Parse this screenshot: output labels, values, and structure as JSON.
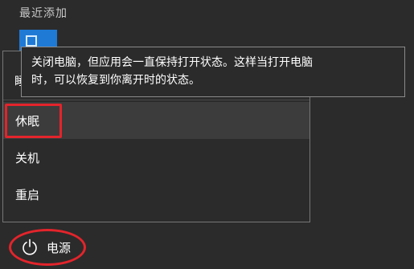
{
  "start": {
    "recent_header": "最近添加"
  },
  "tooltip": {
    "text_line1": "关闭电脑，但应用会一直保持打开状态。这样当打开电脑",
    "text_line2": "时，可以恢复到你离开时的状态。"
  },
  "power_menu": {
    "partial_label": "睡",
    "items": [
      {
        "label": "休眠"
      },
      {
        "label": "关机"
      },
      {
        "label": "重启"
      }
    ]
  },
  "power_button": {
    "label": "电源",
    "icon": "power-icon"
  },
  "colors": {
    "background": "#2b2b2b",
    "highlight": "#e3242b",
    "tile": "#1f7ad6"
  }
}
